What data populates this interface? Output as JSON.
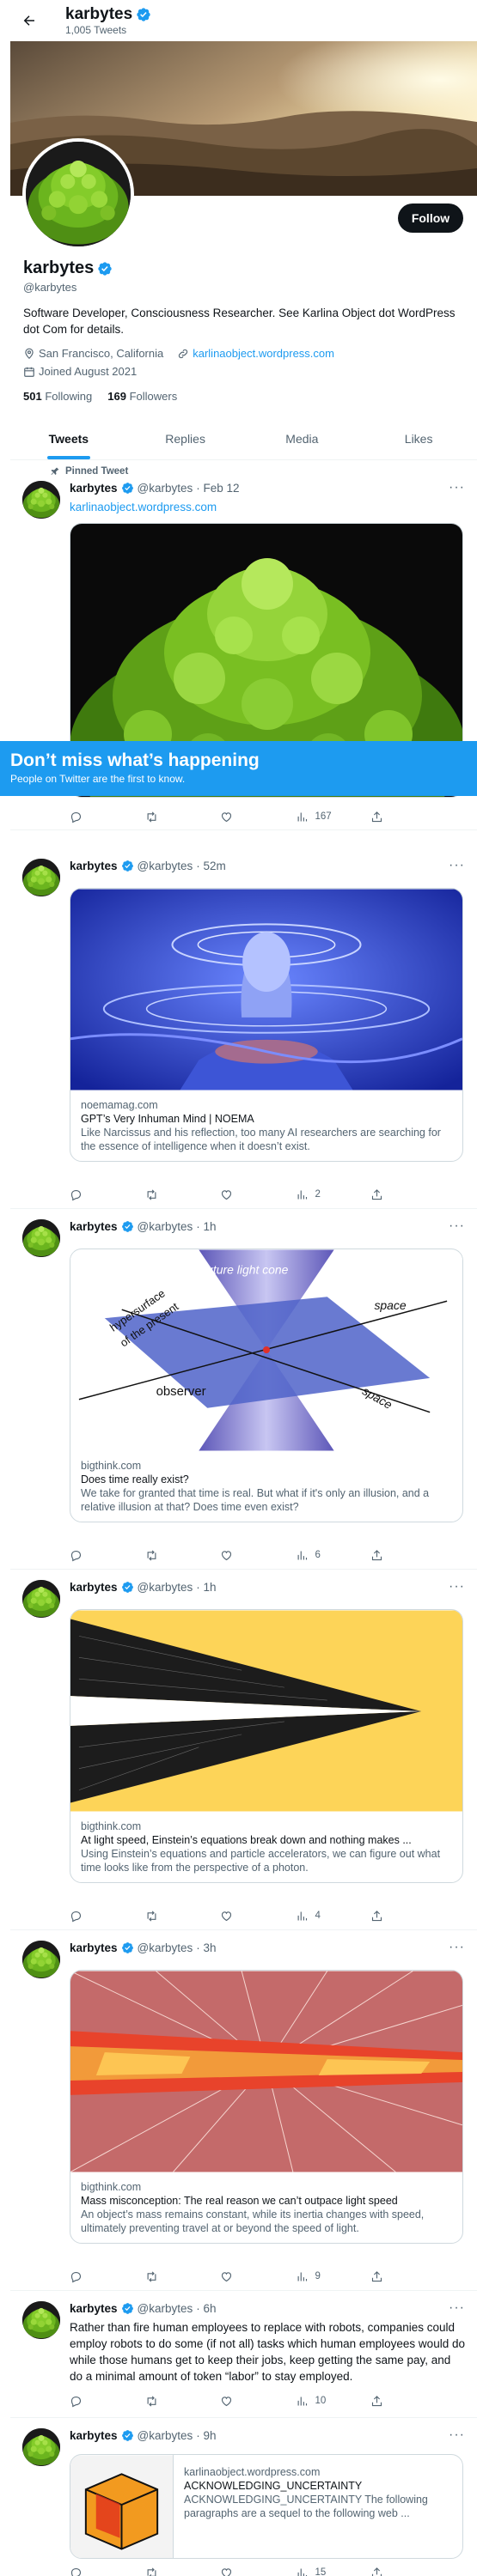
{
  "header": {
    "name": "karbytes",
    "tweet_count": "1,005 Tweets"
  },
  "profile": {
    "name": "karbytes",
    "handle": "@karbytes",
    "bio": "Software Developer, Consciousness Researcher. See Karlina Object dot WordPress dot Com for details.",
    "location": "San Francisco, California",
    "website": "karlinaobject.wordpress.com",
    "joined": "Joined August 2021",
    "following_count": "501",
    "following_label": "Following",
    "followers_count": "169",
    "followers_label": "Followers",
    "follow_button": "Follow"
  },
  "tabs": [
    "Tweets",
    "Replies",
    "Media",
    "Likes"
  ],
  "pinned_label": "Pinned Tweet",
  "cta": {
    "title": "Don’t miss what’s happening",
    "subtitle": "People on Twitter are the first to know."
  },
  "tweets": [
    {
      "name": "karbytes",
      "handle": "@karbytes",
      "time": "· Feb 12",
      "text": "karlinaobject.wordpress.com",
      "views": "167"
    },
    {
      "name": "karbytes",
      "handle": "@karbytes",
      "time": "· 52m",
      "card": {
        "domain": "noemamag.com",
        "title": "GPT’s Very Inhuman Mind | NOEMA",
        "desc": "Like Narcissus and his reflection, too many AI researchers are searching for the essence of intelligence when it doesn’t exist."
      },
      "views": "2"
    },
    {
      "name": "karbytes",
      "handle": "@karbytes",
      "time": "· 1h",
      "card": {
        "domain": "bigthink.com",
        "title": "Does time really exist?",
        "desc": "We take for granted that time is real. But what if it's only an illusion, and a relative illusion at that? Does time even exist?",
        "img_labels": {
          "cone": "future light cone",
          "surface_a": "hypersurface",
          "surface_b": "of the present",
          "observer": "observer",
          "space1": "space",
          "space2": "space"
        }
      },
      "views": "6"
    },
    {
      "name": "karbytes",
      "handle": "@karbytes",
      "time": "· 1h",
      "card": {
        "domain": "bigthink.com",
        "title": "At light speed, Einstein’s equations break down and nothing makes ...",
        "desc": "Using Einstein’s equations and particle accelerators, we can figure out what time looks like from the perspective of a photon."
      },
      "views": "4"
    },
    {
      "name": "karbytes",
      "handle": "@karbytes",
      "time": "· 3h",
      "card": {
        "domain": "bigthink.com",
        "title": "Mass misconception: The real reason we can’t outpace light speed",
        "desc": "An object’s mass remains constant, while its inertia changes with speed, ultimately preventing travel at or beyond the speed of light."
      },
      "views": "9"
    },
    {
      "name": "karbytes",
      "handle": "@karbytes",
      "time": "· 6h",
      "text": "Rather than fire human employees to replace with robots, companies could employ robots to do some (if not all) tasks which human employees would do while those humans get to keep their jobs, keep getting the same pay, and do a minimal amount of token “labor” to stay employed.",
      "views": "10"
    },
    {
      "name": "karbytes",
      "handle": "@karbytes",
      "time": "· 9h",
      "card": {
        "domain": "karlinaobject.wordpress.com",
        "title": "ACKNOWLEDGING_UNCERTAINTY",
        "desc": "ACKNOWLEDGING_UNCERTAINTY The following paragraphs are a sequel to the following web ..."
      },
      "views": "15"
    }
  ],
  "colors": {
    "accent": "#1d9bf0",
    "text": "#0f1419",
    "muted": "#536471",
    "border": "#cfd9de"
  },
  "icons": [
    "back-arrow-icon",
    "verified-badge-icon",
    "location-pin-icon",
    "link-icon",
    "calendar-icon",
    "pin-icon",
    "reply-icon",
    "retweet-icon",
    "like-icon",
    "views-icon",
    "share-icon",
    "more-icon"
  ]
}
